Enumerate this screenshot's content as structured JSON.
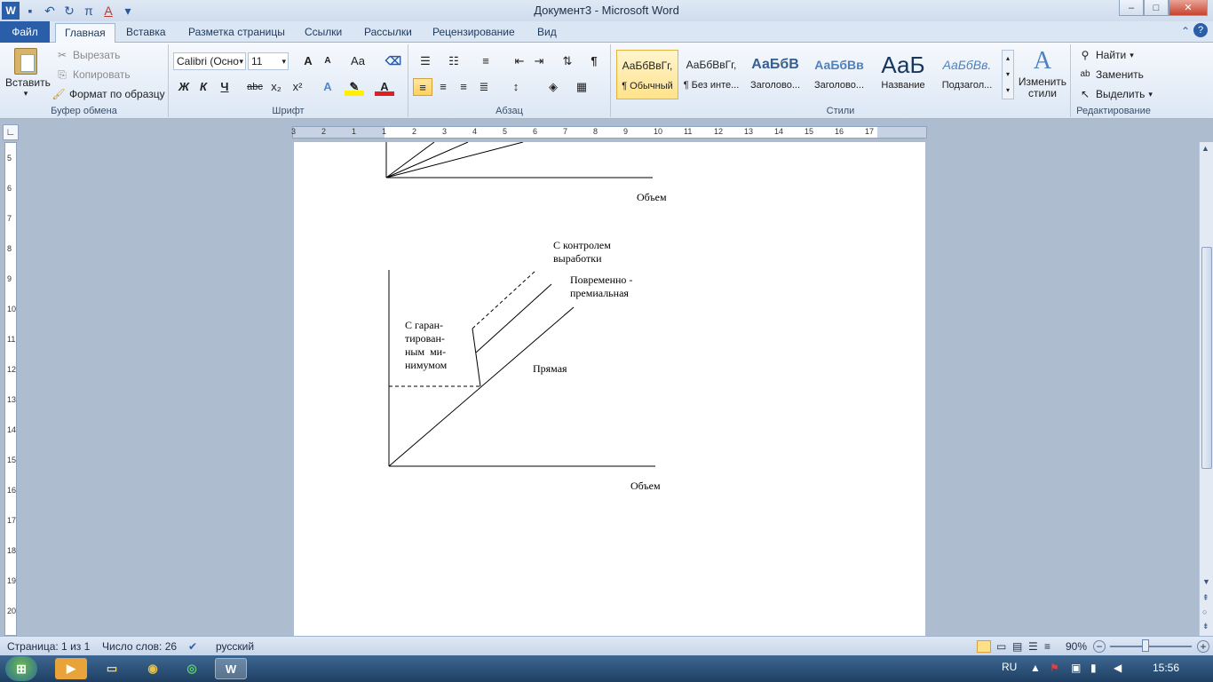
{
  "window": {
    "title": "Документ3 - Microsoft Word",
    "buttons": {
      "minimize": "–",
      "maximize": "□",
      "close": "✕"
    }
  },
  "quick_access": {
    "save": "💾",
    "undo": "↶",
    "redo": "↻",
    "pi": "π",
    "color": "A",
    "more": "▾",
    "word": "W"
  },
  "tabs": [
    "Файл",
    "Главная",
    "Вставка",
    "Разметка страницы",
    "Ссылки",
    "Рассылки",
    "Рецензирование",
    "Вид"
  ],
  "ribbon": {
    "clipboard": {
      "label": "Буфер обмена",
      "paste": "Вставить",
      "cut": "Вырезать",
      "copy": "Копировать",
      "format_painter": "Формат по образцу"
    },
    "font": {
      "label": "Шрифт",
      "font_name": "Calibri (Осно",
      "font_size": "11",
      "grow": "A",
      "shrink": "A",
      "case": "Aa",
      "bold": "Ж",
      "italic": "К",
      "underline": "Ч",
      "strike": "abc",
      "subscript": "x₂",
      "superscript": "x²"
    },
    "paragraph": {
      "label": "Абзац",
      "pilcrow": "¶"
    },
    "styles": {
      "label": "Стили",
      "items": [
        {
          "sample": "АаБбВвГг,",
          "name": "¶ Обычный"
        },
        {
          "sample": "АаБбВвГг,",
          "name": "¶ Без инте..."
        },
        {
          "sample": "АаБбВ",
          "name": "Заголово..."
        },
        {
          "sample": "АаБбВв",
          "name": "Заголово..."
        },
        {
          "sample": "АаБ",
          "name": "Название"
        },
        {
          "sample": "АаБбВв.",
          "name": "Подзагол..."
        }
      ],
      "change_styles": "Изменить стили"
    },
    "editing": {
      "label": "Редактирование",
      "find": "Найти",
      "replace": "Заменить",
      "select": "Выделить"
    }
  },
  "ruler": {
    "h_ticks": [
      "3",
      "2",
      "1",
      "1",
      "2",
      "3",
      "4",
      "5",
      "6",
      "7",
      "8",
      "9",
      "10",
      "11",
      "12",
      "13",
      "14",
      "15",
      "16",
      "17"
    ],
    "v_ticks": [
      "5",
      "6",
      "7",
      "8",
      "9",
      "10",
      "11",
      "12",
      "13",
      "14",
      "15",
      "16",
      "17",
      "18",
      "19",
      "20"
    ]
  },
  "document": {
    "top_chart": {
      "xlabel": "Объем"
    },
    "chart": {
      "xlabel": "Объем",
      "label_control": [
        "С контролем",
        "выработки"
      ],
      "label_time_premium": [
        "Повременно -",
        "премиальная"
      ],
      "label_guaranteed": [
        "С гаран-",
        "тирован-",
        "ным  ми-",
        "нимумом"
      ],
      "label_direct": "Прямая"
    }
  },
  "statusbar": {
    "page": "Страница: 1 из 1",
    "words": "Число слов: 26",
    "language": "русский",
    "zoom": "90%",
    "zoom_minus": "−",
    "zoom_plus": "+"
  },
  "taskbar": {
    "lang": "RU",
    "time": "15:56",
    "word_icon": "W",
    "media_icon": "▶",
    "chrome_icon": "◉",
    "folder_icon": "▭",
    "other_icon": "◎"
  }
}
